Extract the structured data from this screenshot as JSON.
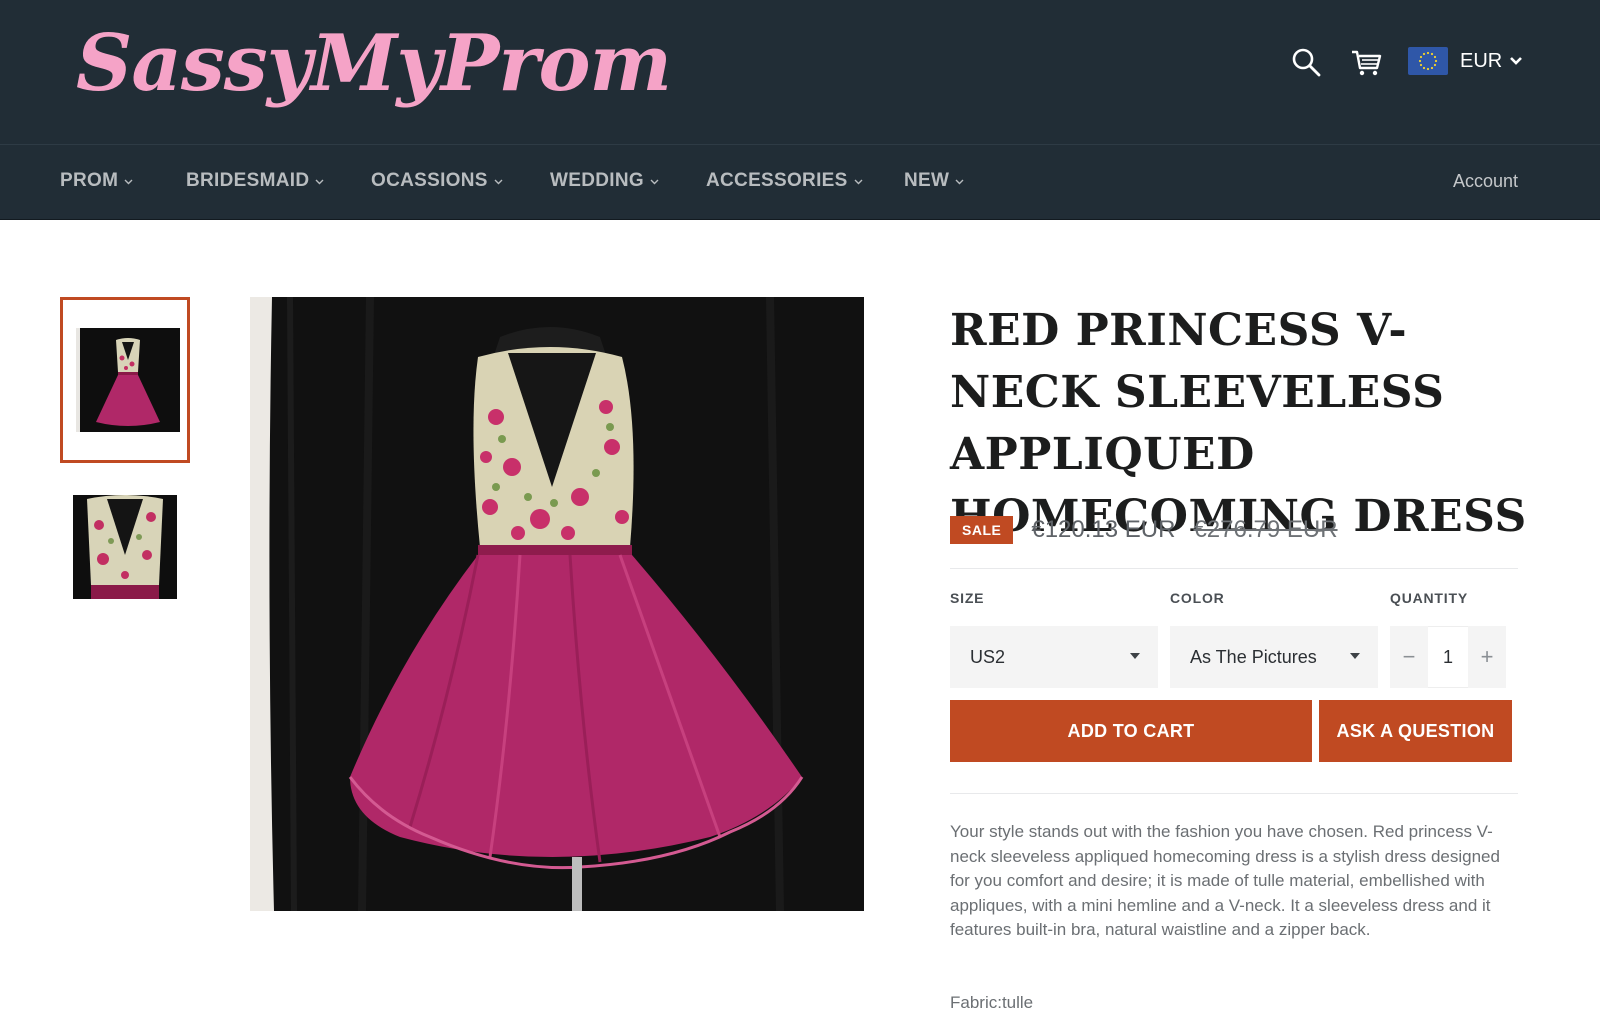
{
  "header": {
    "logo_prefix": "Sassy",
    "logo_mid": "My",
    "logo_suffix": "Prom",
    "currency": {
      "flag": "eu-flag-icon",
      "code": "EUR"
    },
    "icons": [
      "search-icon",
      "cart-icon",
      "chevron-down-icon"
    ]
  },
  "nav": {
    "items": [
      {
        "label": "PROM"
      },
      {
        "label": "BRIDESMAID"
      },
      {
        "label": "OCASSIONS"
      },
      {
        "label": "WEDDING"
      },
      {
        "label": "ACCESSORIES"
      },
      {
        "label": "NEW"
      }
    ],
    "account": "Account"
  },
  "product": {
    "title": "RED PRINCESS V-NECK SLEEVELESS APPLIQUED HOMECOMING DRESS",
    "sale_badge": "SALE",
    "price": "€120.13 EUR",
    "compare_price": "€276.79 EUR",
    "options": {
      "size_label": "SIZE",
      "size_value": "US2",
      "color_label": "COLOR",
      "color_value": "As The Pictures",
      "quantity_label": "QUANTITY",
      "quantity_value": "1",
      "minus": "−",
      "plus": "+"
    },
    "add_to_cart": "ADD TO CART",
    "ask_question": "ASK A QUESTION",
    "description": "Your style stands out with the fashion you have chosen. Red princess V-neck sleeveless appliqued homecoming dress is a stylish dress designed for you comfort and desire; it is made of tulle material, embellished with appliques, with a mini hemline and a V-neck. It a sleeveless dress and it features built-in bra, natural waistline and a zipper back.",
    "fabric": "Fabric:tulle"
  },
  "colors": {
    "header_bg": "#212d36",
    "accent": "#c04a22",
    "logo_pink": "#f5a3c7",
    "dress_pink": "#b02868"
  }
}
